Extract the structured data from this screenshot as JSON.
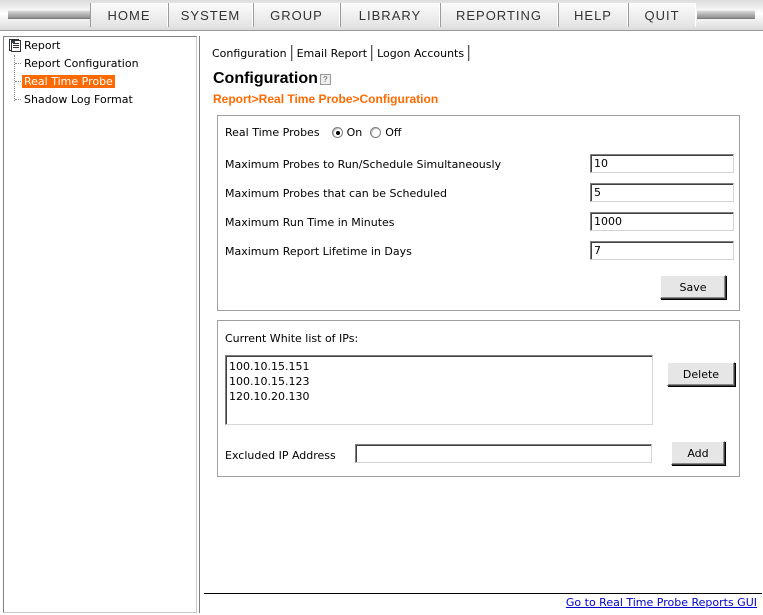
{
  "menu": {
    "items": [
      {
        "label": "HOME"
      },
      {
        "label": "SYSTEM"
      },
      {
        "label": "GROUP"
      },
      {
        "label": "LIBRARY"
      },
      {
        "label": "REPORTING"
      },
      {
        "label": "HELP"
      },
      {
        "label": "QUIT"
      }
    ]
  },
  "tree": {
    "root": {
      "label": "Report",
      "icon": "document-icon"
    },
    "nodes": [
      {
        "label": "Report Configuration",
        "selected": false
      },
      {
        "label": "Real Time Probe",
        "selected": true
      },
      {
        "label": "Shadow Log Format",
        "selected": false
      }
    ]
  },
  "tabs": [
    {
      "label": "Configuration"
    },
    {
      "label": "Email Report"
    },
    {
      "label": "Logon Accounts"
    }
  ],
  "page": {
    "title": "Configuration",
    "help_icon": "?",
    "breadcrumb": "Report>Real Time Probe>Configuration"
  },
  "config": {
    "probes_label": "Real Time Probes",
    "probes_on_label": "On",
    "probes_off_label": "Off",
    "probes_selected": "On",
    "fields": [
      {
        "label": "Maximum Probes to Run/Schedule Simultaneously",
        "value": "10"
      },
      {
        "label": "Maximum Probes that can be Scheduled",
        "value": "5"
      },
      {
        "label": "Maximum Run Time in Minutes",
        "value": "1000"
      },
      {
        "label": "Maximum Report Lifetime in Days",
        "value": "7"
      }
    ],
    "save_label": "Save"
  },
  "whitelist": {
    "heading": "Current White list of IPs:",
    "ips": [
      "100.10.15.151",
      "100.10.15.123",
      "120.10.20.130"
    ],
    "delete_label": "Delete",
    "excluded_label": "Excluded IP Address",
    "excluded_value": "",
    "add_label": "Add"
  },
  "footer": {
    "link": "Go to Real Time Probe Reports GUI"
  },
  "colors": {
    "accent": "#ff6a00",
    "link": "#0000cc"
  }
}
